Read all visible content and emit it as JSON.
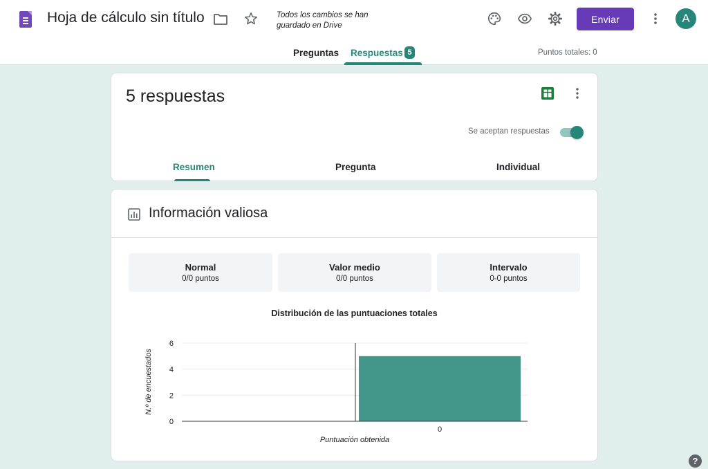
{
  "header": {
    "title": "Hoja de cálculo sin título",
    "save_status": "Todos los cambios se han guardado en Drive",
    "send_label": "Enviar",
    "avatar_letter": "A",
    "icons": [
      "forms-app-icon",
      "folder-icon",
      "star-icon",
      "palette-icon",
      "eye-icon",
      "gear-icon",
      "more-vert-icon"
    ]
  },
  "tabs": {
    "questions": "Preguntas",
    "responses": "Respuestas",
    "responses_badge": "5",
    "total_points": "Puntos totales: 0"
  },
  "summary_card": {
    "count_label": "5 respuestas",
    "accepting_label": "Se aceptan respuestas",
    "accepting": true,
    "subtabs": [
      "Resumen",
      "Pregunta",
      "Individual"
    ],
    "active_subtab": "Resumen"
  },
  "insights": {
    "title": "Información valiosa",
    "stats": [
      {
        "label": "Normal",
        "value": "0/0 puntos"
      },
      {
        "label": "Valor medio",
        "value": "0/0 puntos"
      },
      {
        "label": "Intervalo",
        "value": "0-0 puntos"
      }
    ]
  },
  "chart_data": {
    "type": "bar",
    "title": "Distribución de las puntuaciones totales",
    "xlabel": "Puntuación obtenida",
    "ylabel": "N.º de encuestados",
    "categories": [
      "0"
    ],
    "values": [
      5
    ],
    "ylim": [
      0,
      6
    ],
    "yticks": [
      "0",
      "2",
      "4",
      "6"
    ],
    "color": "#42968a",
    "grid": true
  },
  "colors": {
    "accent": "#26867a",
    "brand_purple": "#673ab7",
    "background": "#e0efec"
  }
}
